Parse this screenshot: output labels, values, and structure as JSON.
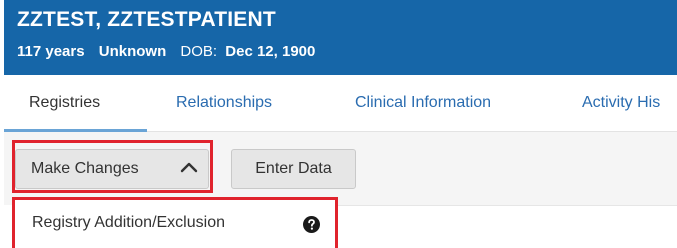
{
  "patient": {
    "name": "ZZTEST, ZZTESTPATIENT",
    "age": "117 years",
    "gender": "Unknown",
    "dob_label": "DOB:",
    "dob_value": "Dec 12, 1900"
  },
  "tabs": [
    {
      "label": "Registries",
      "active": true
    },
    {
      "label": "Relationships",
      "active": false
    },
    {
      "label": "Clinical Information",
      "active": false
    },
    {
      "label": "Activity His",
      "active": false
    }
  ],
  "toolbar": {
    "make_changes_label": "Make Changes",
    "enter_data_label": "Enter Data"
  },
  "dropdown": {
    "items": [
      {
        "label": "Registry Addition/Exclusion",
        "icon": "help-circle-icon"
      }
    ]
  },
  "colors": {
    "banner": "#1666a8",
    "link": "#2a6cb0",
    "highlight": "#e0232d"
  }
}
